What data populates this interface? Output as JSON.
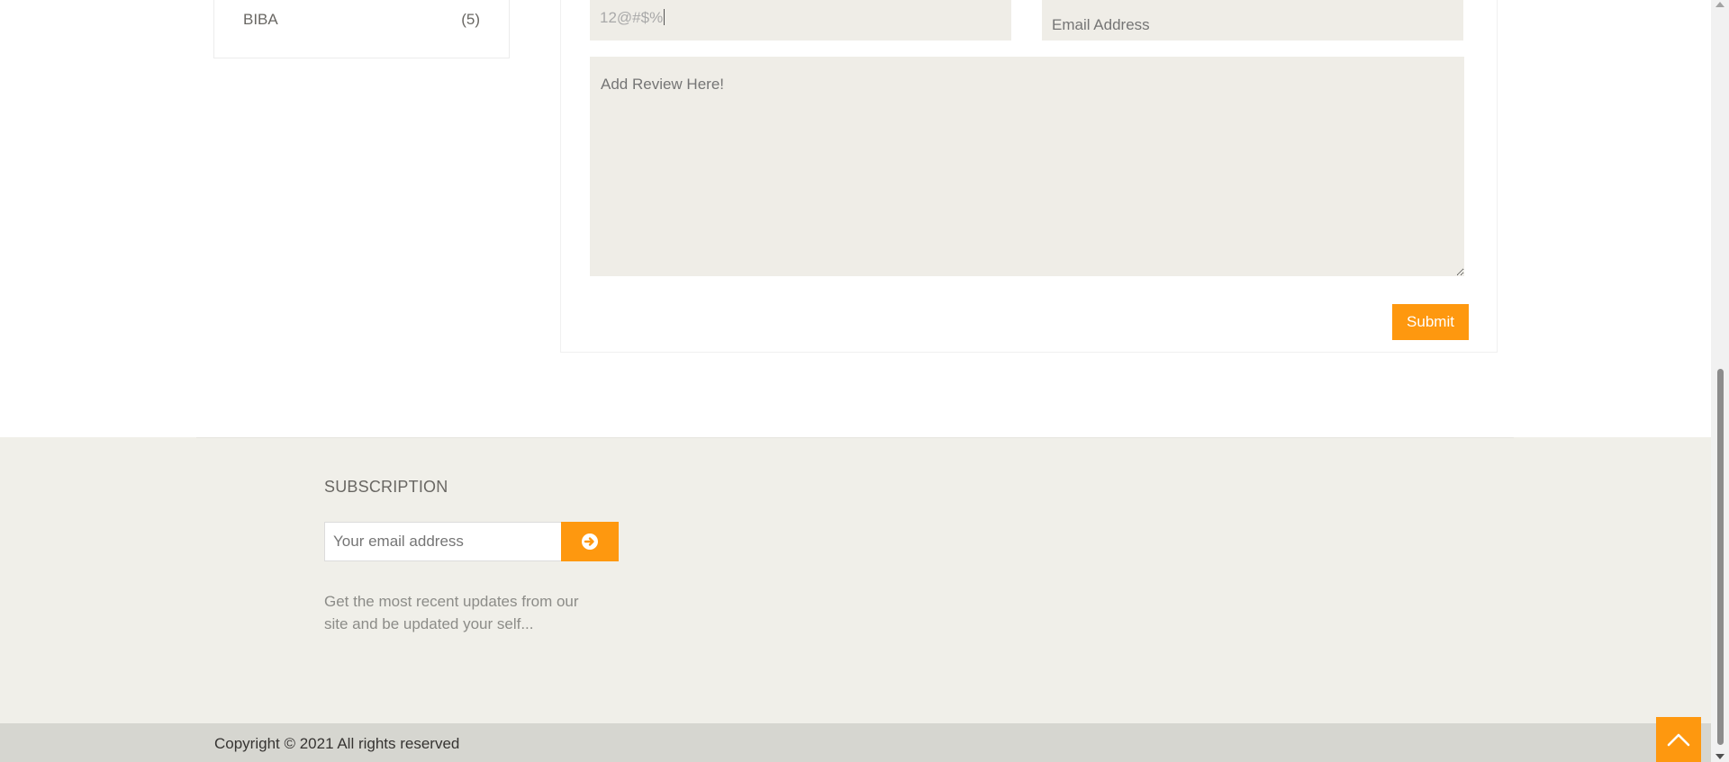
{
  "sidebar": {
    "brands": [
      {
        "name": "BIBA",
        "count": "(5)"
      }
    ]
  },
  "review_form": {
    "name_value": "12@#$%",
    "email_placeholder": "Email Address",
    "review_placeholder": "Add Review Here!",
    "submit_label": "Submit"
  },
  "subscription": {
    "title": "SUBSCRIPTION",
    "email_placeholder": "Your email address",
    "button_icon": "arrow-circle-right-icon",
    "description": "Get the most recent updates from our site and be updated your self..."
  },
  "footer": {
    "copyright": "Copyright © 2021 All rights reserved"
  },
  "scroll_top": {
    "icon": "chevron-up-icon"
  },
  "colors": {
    "accent": "#fe980f",
    "field_bg": "#efede7",
    "footer_bg": "#f0efe9",
    "footer_bottom_bg": "#d6d6d0"
  }
}
